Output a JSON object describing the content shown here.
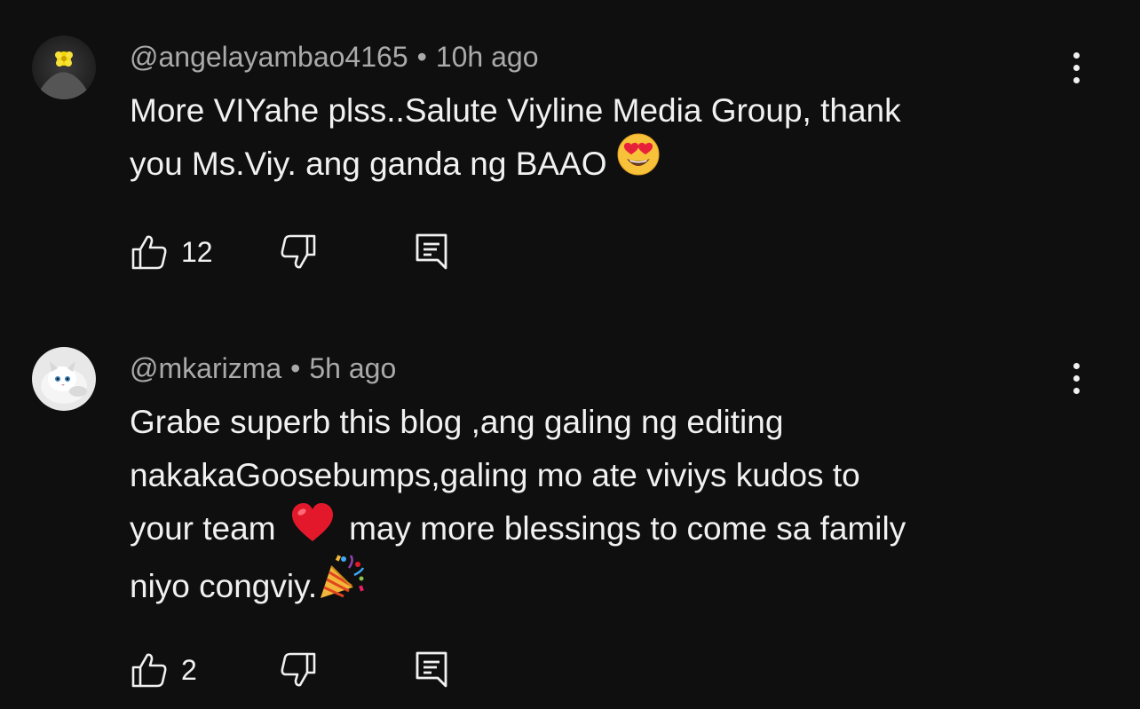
{
  "comments": [
    {
      "author": "@angelayambao4165",
      "separator": "•",
      "time": "10h ago",
      "lines": [
        "More VIYahe plss..Salute Viyline Media Group, thank",
        "you Ms.Viy. ang ganda ng BAAO"
      ],
      "emoji": "smiling-face-with-heart-eyes",
      "likes": "12"
    },
    {
      "author": "@mkarizma",
      "separator": "•",
      "time": "5h ago",
      "lines": [
        "Grabe superb this blog ,ang galing ng editing",
        "nakakaGoosebumps,galing mo ate viviys kudos to",
        "your team",
        "may more blessings to come sa family",
        "niyo congviy."
      ],
      "emoji_inline": [
        "red-heart",
        "party-popper"
      ],
      "likes": "2"
    }
  ],
  "icons": {
    "like": "thumbs-up-icon",
    "dislike": "thumbs-down-icon",
    "reply": "reply-icon",
    "more": "vertical-ellipsis-icon"
  }
}
